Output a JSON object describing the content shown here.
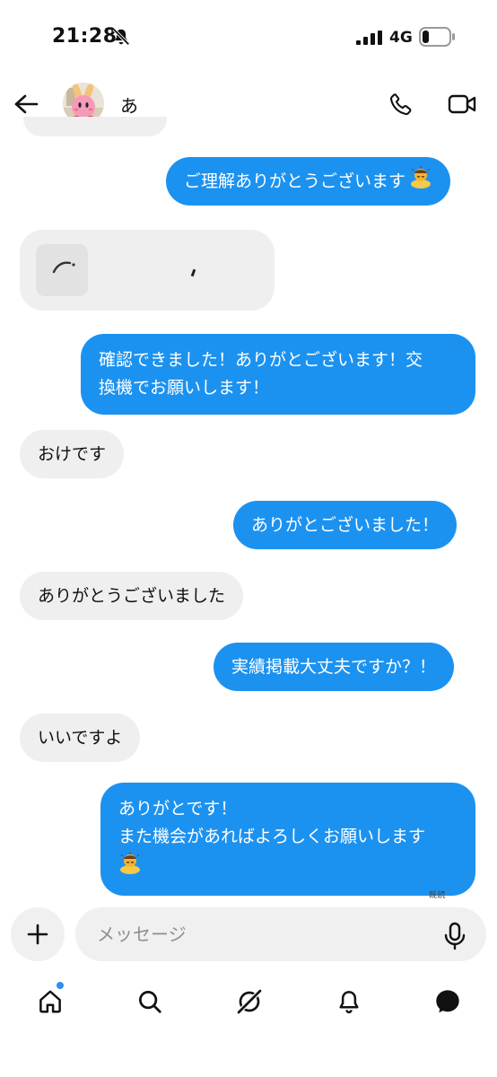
{
  "status_bar": {
    "time": "21:28",
    "network": "4G",
    "battery_level": 0.25
  },
  "header": {
    "contact_name": "あ"
  },
  "reply_card": {},
  "messages": [
    {
      "side": "out",
      "text": "ご理解ありがとうございます",
      "emoji": "person-bowing-emoji"
    },
    {
      "side": "out",
      "lines": [
        "確認できました！ありがとございます！交",
        "換機でお願いします！"
      ]
    },
    {
      "side": "in",
      "text": "おけです"
    },
    {
      "side": "out",
      "text": "ありがとございました！"
    },
    {
      "side": "in",
      "text": "ありがとうございました"
    },
    {
      "side": "out",
      "text": "実績掲載大丈夫ですか？！"
    },
    {
      "side": "in",
      "text": "いいですよ"
    },
    {
      "side": "out",
      "lines": [
        "ありがとです！",
        "また機会があればよろしくお願いします"
      ],
      "emoji": "person-bowing-emoji"
    }
  ],
  "seen_label": "既読",
  "composer": {
    "placeholder": "メッセージ"
  },
  "tabs": [
    "home-icon",
    "search-icon",
    "explore-icon",
    "notifications-icon",
    "messages-icon"
  ],
  "colors": {
    "outgoing": "#1c92f0",
    "incoming": "#efefef",
    "notification_dot": "#2f8ef4"
  }
}
